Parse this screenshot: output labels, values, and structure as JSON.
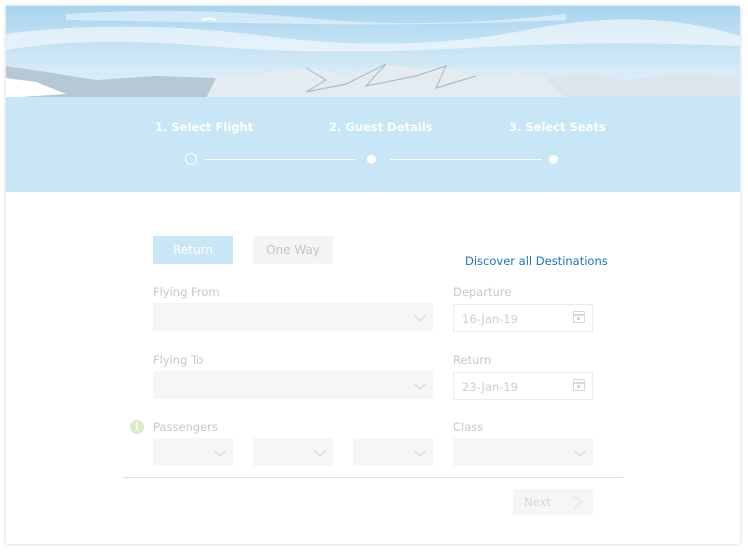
{
  "steps": [
    {
      "label": "1. Select Flight",
      "state": "active"
    },
    {
      "label": "2. Guest Details",
      "state": "pending"
    },
    {
      "label": "3. Select Seats",
      "state": "pending"
    }
  ],
  "trip_type": {
    "return_label": "Return",
    "oneway_label": "One Way",
    "selected": "Return"
  },
  "discover_link": "Discover all Destinations",
  "fields": {
    "flying_from": {
      "label": "Flying From",
      "value": ""
    },
    "flying_to": {
      "label": "Flying To",
      "value": ""
    },
    "departure": {
      "label": "Departure",
      "value": "16-Jan-19"
    },
    "return": {
      "label": "Return",
      "value": "23-Jan-19"
    },
    "passengers": {
      "label": "Passengers",
      "info_glyph": "i"
    },
    "class": {
      "label": "Class",
      "value": ""
    }
  },
  "next_button": {
    "label": "Next"
  },
  "colors": {
    "accent": "#c8e6f5",
    "link": "#1a73c9",
    "field_bg": "#f6f6f6"
  },
  "icons": {
    "chevron": "chevron-down-icon",
    "calendar": "calendar-icon",
    "info": "info-icon",
    "arrow": "arrow-right-icon"
  }
}
